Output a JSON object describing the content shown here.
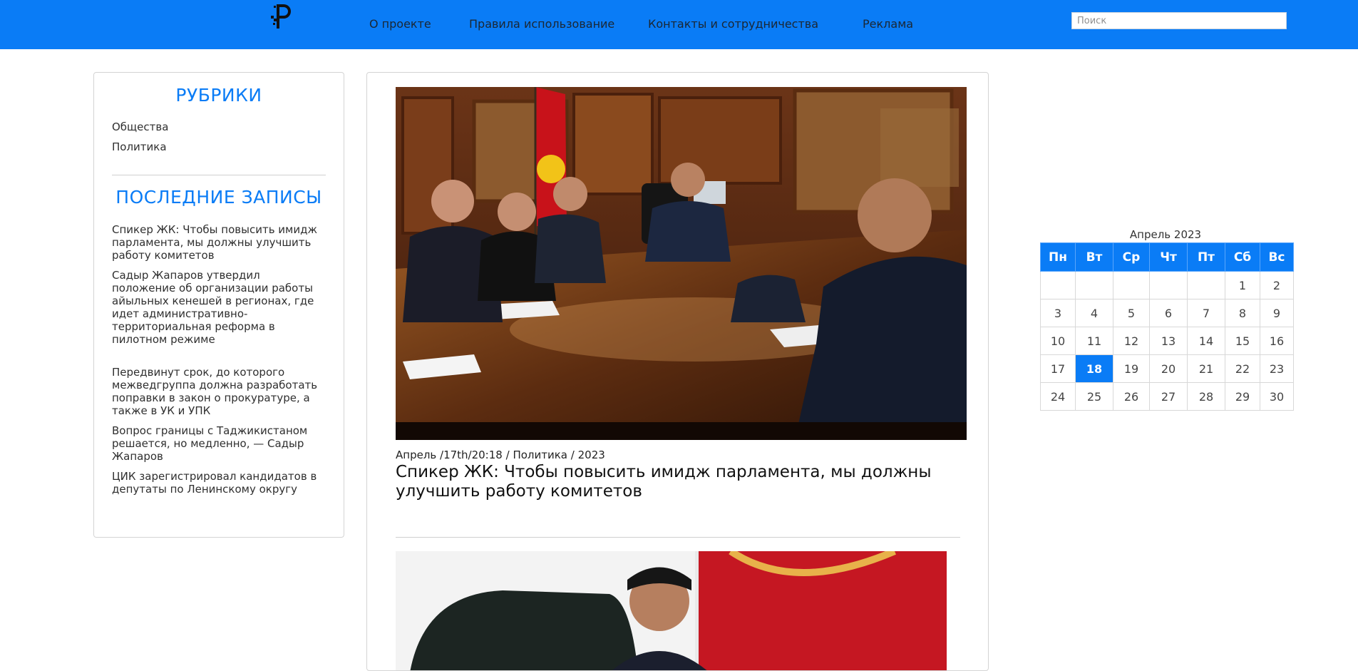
{
  "header": {
    "nav": [
      {
        "label": "О проекте"
      },
      {
        "label": "Правила использование"
      },
      {
        "label": "Контакты и сотрудничества"
      },
      {
        "label": "Реклама"
      }
    ],
    "search_placeholder": "Поиск",
    "logo_icon": "site-logo-icon"
  },
  "sidebar": {
    "rubrics_heading": "РУБРИКИ",
    "rubrics": [
      {
        "label": "Общества"
      },
      {
        "label": "Политика"
      }
    ],
    "recent_heading": "ПОСЛЕДНИЕ ЗАПИСЫ",
    "recent_posts": [
      {
        "title": "Спикер ЖК: Чтобы повысить имидж парламента, мы должны улучшить работу комитетов"
      },
      {
        "title": "Садыр Жапаров утвердил положение об организации работы айыльных кенешей в регионах, где идет административно-территориальная реформа в пилотном режиме"
      },
      {
        "title": "Передвинут срок, до которого межведгруппа должна разработать поправки в закон о прокуратуре, а также в УК и УПК"
      },
      {
        "title": "Вопрос границы с Таджикистаном решается, но медленно, — Садыр Жапаров"
      },
      {
        "title": "ЦИК зарегистрировал кандидатов в депутаты по Ленинскому округу"
      }
    ]
  },
  "main": {
    "articles": [
      {
        "meta_date": "Апрель /17th/20:18",
        "meta_sep": "/",
        "meta_category": "Политика",
        "meta_year": "2023",
        "title": "Спикер ЖК: Чтобы повысить имидж парламента, мы должны улучшить работу комитетов"
      }
    ]
  },
  "calendar": {
    "caption": "Апрель 2023",
    "weekdays": [
      "Пн",
      "Вт",
      "Ср",
      "Чт",
      "Пт",
      "Сб",
      "Вс"
    ],
    "weeks": [
      [
        "",
        "",
        "",
        "",
        "",
        "1",
        "2"
      ],
      [
        "3",
        "4",
        "5",
        "6",
        "7",
        "8",
        "9"
      ],
      [
        "10",
        "11",
        "12",
        "13",
        "14",
        "15",
        "16"
      ],
      [
        "17",
        "18",
        "19",
        "20",
        "21",
        "22",
        "23"
      ],
      [
        "24",
        "25",
        "26",
        "27",
        "28",
        "29",
        "30"
      ]
    ],
    "today": "18"
  },
  "colors": {
    "accent": "#0a7cf6",
    "nav_text": "#1b2733",
    "body_text": "#2f2f2f"
  }
}
